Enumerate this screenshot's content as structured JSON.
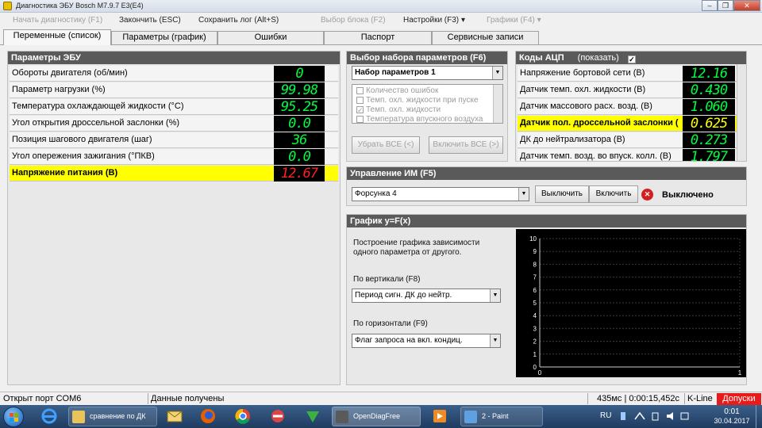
{
  "window": {
    "title": "Диагностика ЭБУ Bosch M7.9.7 E3(E4)",
    "controls": {
      "minimize": "–",
      "restore": "❐",
      "close": "✕"
    }
  },
  "menu": {
    "start_diag": "Начать диагностику (F1)",
    "finish": "Закончить (ESC)",
    "save_log": "Сохранить лог (Alt+S)",
    "select_block": "Выбор блока (F2)",
    "settings": "Настройки (F3)",
    "graphs": "Графики (F4)",
    "dropdown_glyph": "▾"
  },
  "tabs": [
    "Переменные (список)",
    "Параметры (график)",
    "Ошибки",
    "Паспорт",
    "Сервисные записи"
  ],
  "ecu_params": {
    "header": "Параметры ЭБУ",
    "rows": [
      {
        "label": "Обороты двигателя (об/мин)",
        "value": "0"
      },
      {
        "label": "Параметр нагрузки (%)",
        "value": "99.98"
      },
      {
        "label": "Температура охлаждающей жидкости (°C)",
        "value": "95.25"
      },
      {
        "label": "Угол открытия дроссельной заслонки (%)",
        "value": "0.0"
      },
      {
        "label": "Позиция шагового двигателя (шаг)",
        "value": "36"
      },
      {
        "label": "Угол опережения зажигания (°ПКВ)",
        "value": "0.0"
      },
      {
        "label": "Напряжение питания (В)",
        "value": "12.67"
      }
    ]
  },
  "param_set": {
    "header": "Выбор набора параметров (F6)",
    "selected": "Набор параметров 1",
    "items": [
      {
        "label": "Количество ошибок",
        "checked": false
      },
      {
        "label": "Темп. охл. жидкости при пуске",
        "checked": false
      },
      {
        "label": "Темп. охл. жидкости",
        "checked": true
      },
      {
        "label": "Температура впускного воздуха",
        "checked": false
      }
    ],
    "remove_all": "Убрать ВСЕ (<)",
    "enable_all": "Включить ВСЕ (>)"
  },
  "adc": {
    "header": "Коды АЦП",
    "shown_label": "(показать)",
    "shown_checked": true,
    "rows": [
      {
        "label": "Напряжение бортовой сети (В)",
        "value": "12.16"
      },
      {
        "label": "Датчик темп. охл. жидкости (В)",
        "value": "0.430"
      },
      {
        "label": "Датчик массового расх. возд. (В)",
        "value": "1.060"
      },
      {
        "label": "Датчик пол. дроссельной заслонки (В)",
        "value": "0.625"
      },
      {
        "label": "ДК до нейтрализатора (В)",
        "value": "0.273"
      },
      {
        "label": "Датчик темп. возд. во впуск. колл. (В)",
        "value": "1.797"
      }
    ]
  },
  "actuator": {
    "header": "Управление ИМ (F5)",
    "selected": "Форсунка 4",
    "off_button": "Выключить",
    "on_button": "Включить",
    "status": "Выключено",
    "status_icon": "✕"
  },
  "graph_yfx": {
    "header": "График y=F(x)",
    "description_line1": "Построение графика зависимости",
    "description_line2": "одного параметра от другого.",
    "vertical_label": "По вертикали (F8)",
    "vertical_value": "Период сигн. ДК до нейтр.",
    "horizontal_label": "По горизонтали (F9)",
    "horizontal_value": "Флаг запроса на вкл. кондиц."
  },
  "chart_data": {
    "type": "line",
    "xlim": [
      0,
      1
    ],
    "ylim": [
      0,
      10
    ],
    "x_ticks": [
      "0",
      "1"
    ],
    "y_ticks": [
      "10",
      "9",
      "8",
      "7",
      "6",
      "5",
      "4",
      "3",
      "2",
      "1",
      "0"
    ],
    "grid": true,
    "series": [
      {
        "x": [],
        "y": []
      }
    ]
  },
  "status": {
    "port": "Открыт порт COM6",
    "data": "Данные получены",
    "timing": "435мс | 0:00:15,452с",
    "line": "K-Line",
    "tolerance": "Допуски",
    "tolerance_color": "#e81b1b"
  },
  "taskbar": {
    "tasks": [
      {
        "label": "сравнение по ДК",
        "color": "#e8c45a"
      },
      {
        "label": "OpenDiagFree",
        "color": "#5a5a5a"
      },
      {
        "label": "2 - Paint",
        "color": "#5fa0e0"
      }
    ],
    "lang": "RU",
    "time": "0:01",
    "date": "30.04.2017"
  }
}
